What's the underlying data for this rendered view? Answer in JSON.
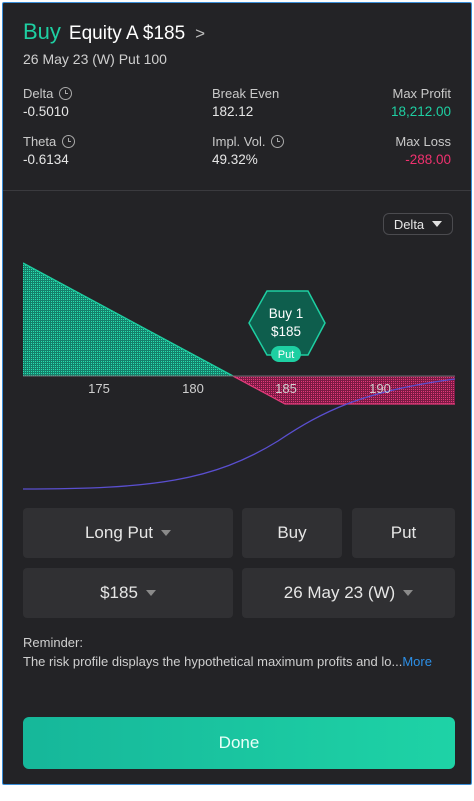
{
  "header": {
    "action": "Buy",
    "symbol": "Equity A",
    "strike": "$185",
    "arrow": ">",
    "contract": "26 May 23 (W) Put 100"
  },
  "stats": {
    "delta_label": "Delta",
    "delta_value": "-0.5010",
    "break_even_label": "Break Even",
    "break_even_value": "182.12",
    "max_profit_label": "Max Profit",
    "max_profit_value": "18,212.00",
    "theta_label": "Theta",
    "theta_value": "-0.6134",
    "iv_label": "Impl. Vol.",
    "iv_value": "49.32%",
    "max_loss_label": "Max Loss",
    "max_loss_value": "-288.00"
  },
  "chart_toggle": {
    "label": "Delta"
  },
  "chart": {
    "x_ticks": [
      "175",
      "180",
      "185",
      "190"
    ],
    "marker": {
      "line1": "Buy 1",
      "line2": "$185",
      "tag": "Put"
    },
    "colors": {
      "profit": "#1ecfa2",
      "loss": "#e23a7a",
      "delta_line": "#5a4fd0"
    }
  },
  "controls": {
    "strategy": "Long Put",
    "side": "Buy",
    "type": "Put",
    "strike": "$185",
    "expiry": "26 May 23 (W)"
  },
  "reminder": {
    "title": "Reminder:",
    "text": "The risk profile displays the hypothetical maximum profits and lo...",
    "more": "More"
  },
  "done_label": "Done"
}
